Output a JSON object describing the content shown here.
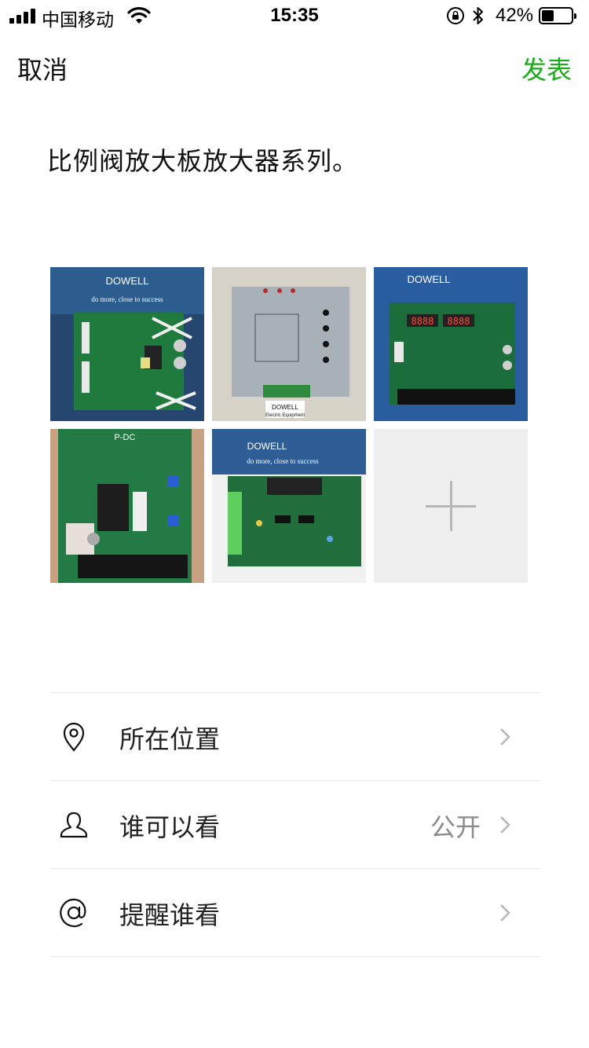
{
  "status_bar": {
    "carrier": "中国移动",
    "time": "15:35",
    "battery_percent_text": "42%",
    "battery_level": 0.42,
    "icons": [
      "signal-icon",
      "wifi-icon",
      "orientation-lock-icon",
      "bluetooth-icon",
      "battery-icon"
    ]
  },
  "nav": {
    "cancel_label": "取消",
    "publish_label": "发表",
    "publish_color": "#1aad19"
  },
  "post": {
    "text": "比例阀放大板放大器系列。"
  },
  "images": {
    "photos": [
      {
        "caption_top": "DOWELL",
        "caption_sub": "do more, close to success"
      },
      {
        "caption_top": "DOWELL",
        "caption_sub": "Electric Equipment"
      },
      {
        "caption_top": "DOWELL",
        "caption_sub": ""
      },
      {
        "caption_top": "P-DC",
        "caption_sub": ""
      },
      {
        "caption_top": "DOWELL",
        "caption_sub": "do more, close to success"
      }
    ],
    "add_icon": "plus-icon"
  },
  "options": [
    {
      "icon": "location-pin-icon",
      "label": "所在位置",
      "value": ""
    },
    {
      "icon": "person-icon",
      "label": "谁可以看",
      "value": "公开"
    },
    {
      "icon": "at-sign-icon",
      "label": "提醒谁看",
      "value": ""
    }
  ]
}
